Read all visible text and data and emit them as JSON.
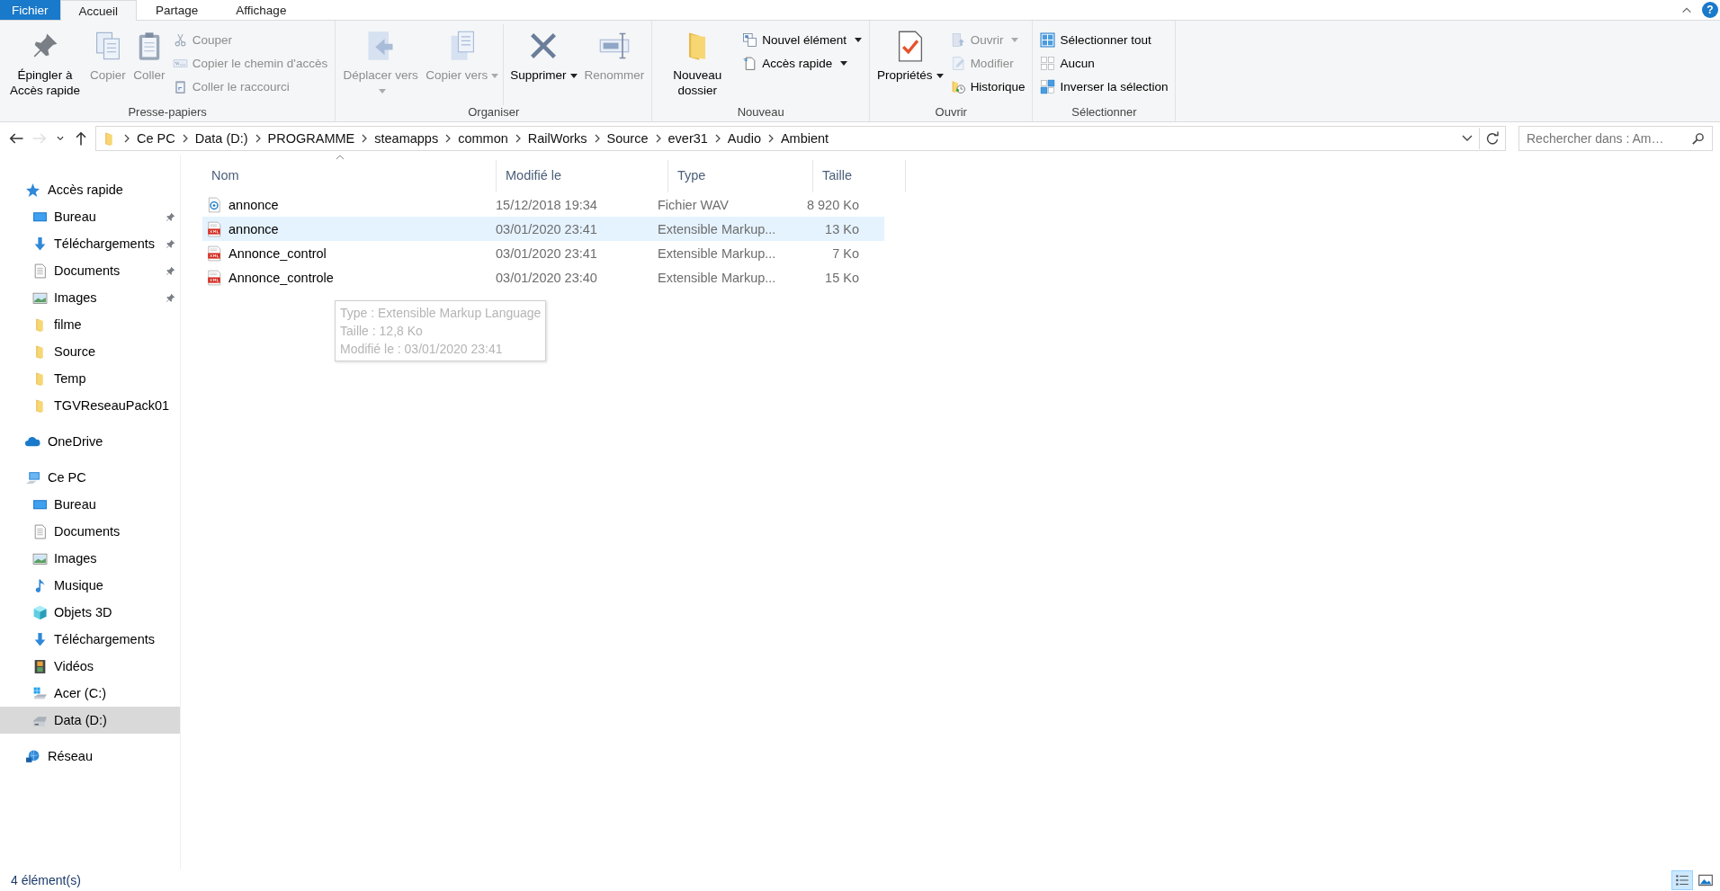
{
  "ribbon_tabs": [
    {
      "label": "Fichier",
      "kind": "file",
      "selected": false
    },
    {
      "label": "Accueil",
      "kind": "tab",
      "selected": true
    },
    {
      "label": "Partage",
      "kind": "tab",
      "selected": false
    },
    {
      "label": "Affichage",
      "kind": "tab",
      "selected": false
    }
  ],
  "help_button": {
    "label": "?"
  },
  "ribbon_groups": [
    {
      "label": "Presse-papiers",
      "large": [
        {
          "label": "Épingler à Accès rapide",
          "kind": "pin",
          "disabled": false,
          "dropdown": false
        },
        {
          "label": "Copier",
          "kind": "copy",
          "disabled": true,
          "dropdown": false
        },
        {
          "label": "Coller",
          "kind": "paste",
          "disabled": true,
          "dropdown": false
        }
      ],
      "small": [
        {
          "label": "Couper",
          "kind": "cut",
          "disabled": true,
          "dropdown": false
        },
        {
          "label": "Copier le chemin d'accès",
          "kind": "copypath",
          "disabled": true,
          "dropdown": false
        },
        {
          "label": "Coller le raccourci",
          "kind": "pasteshortcut",
          "disabled": true,
          "dropdown": false
        }
      ]
    },
    {
      "label": "Organiser",
      "large": [
        {
          "label": "Déplacer vers",
          "kind": "move",
          "disabled": true,
          "dropdown": true
        },
        {
          "label": "Copier vers",
          "kind": "copyto",
          "disabled": true,
          "dropdown": true
        },
        {
          "label": "Supprimer",
          "kind": "delete",
          "disabled": false,
          "dropdown": true
        },
        {
          "label": "Renommer",
          "kind": "rename",
          "disabled": true,
          "dropdown": false
        }
      ]
    },
    {
      "label": "Nouveau",
      "large": [
        {
          "label": "Nouveau dossier",
          "kind": "newfolder",
          "disabled": false,
          "dropdown": false
        }
      ],
      "small": [
        {
          "label": "Nouvel élément",
          "kind": "newitem",
          "disabled": false,
          "dropdown": true
        },
        {
          "label": "Accès rapide",
          "kind": "easyaccess",
          "disabled": false,
          "dropdown": true
        }
      ]
    },
    {
      "label": "Ouvrir",
      "large": [
        {
          "label": "Propriétés",
          "kind": "properties",
          "disabled": false,
          "dropdown": true
        }
      ],
      "small": [
        {
          "label": "Ouvrir",
          "kind": "open",
          "disabled": true,
          "dropdown": true
        },
        {
          "label": "Modifier",
          "kind": "edit",
          "disabled": true,
          "dropdown": false
        },
        {
          "label": "Historique",
          "kind": "history",
          "disabled": false,
          "dropdown": false
        }
      ]
    },
    {
      "label": "Sélectionner",
      "small": [
        {
          "label": "Sélectionner tout",
          "kind": "selectall",
          "disabled": false,
          "dropdown": false
        },
        {
          "label": "Aucun",
          "kind": "selectnone",
          "disabled": false,
          "dropdown": false
        },
        {
          "label": "Inverser la sélection",
          "kind": "invert",
          "disabled": false,
          "dropdown": false
        }
      ]
    }
  ],
  "nav_buttons": [
    {
      "kind": "back",
      "disabled": false
    },
    {
      "kind": "forward",
      "disabled": true
    },
    {
      "kind": "recent",
      "disabled": false
    },
    {
      "kind": "up",
      "disabled": false
    }
  ],
  "breadcrumb": [
    "Ce PC",
    "Data (D:)",
    "PROGRAMME",
    "steamapps",
    "common",
    "RailWorks",
    "Source",
    "ever31",
    "Audio",
    "Ambient"
  ],
  "search": {
    "placeholder": "Rechercher dans : Am…"
  },
  "sidebar": {
    "items": [
      {
        "label": "Accès rapide",
        "kind": "star",
        "selected": false,
        "pinned": false,
        "children": [
          {
            "label": "Bureau",
            "kind": "desktop",
            "selected": false,
            "pinned": true
          },
          {
            "label": "Téléchargements",
            "kind": "download",
            "selected": false,
            "pinned": true
          },
          {
            "label": "Documents",
            "kind": "documents",
            "selected": false,
            "pinned": true
          },
          {
            "label": "Images",
            "kind": "pictures",
            "selected": false,
            "pinned": true
          },
          {
            "label": "filme",
            "kind": "folder",
            "selected": false,
            "pinned": false
          },
          {
            "label": "Source",
            "kind": "folder",
            "selected": false,
            "pinned": false
          },
          {
            "label": "Temp",
            "kind": "folder",
            "selected": false,
            "pinned": false
          },
          {
            "label": "TGVReseauPack01",
            "kind": "folder",
            "selected": false,
            "pinned": false
          }
        ]
      },
      {
        "label": "OneDrive",
        "kind": "cloud",
        "selected": false,
        "pinned": false
      },
      {
        "label": "Ce PC",
        "kind": "pc",
        "selected": false,
        "pinned": false,
        "children": [
          {
            "label": "Bureau",
            "kind": "desktop",
            "selected": false,
            "pinned": false
          },
          {
            "label": "Documents",
            "kind": "documents",
            "selected": false,
            "pinned": false
          },
          {
            "label": "Images",
            "kind": "pictures",
            "selected": false,
            "pinned": false
          },
          {
            "label": "Musique",
            "kind": "music",
            "selected": false,
            "pinned": false
          },
          {
            "label": "Objets 3D",
            "kind": "cube",
            "selected": false,
            "pinned": false
          },
          {
            "label": "Téléchargements",
            "kind": "download",
            "selected": false,
            "pinned": false
          },
          {
            "label": "Vidéos",
            "kind": "videos",
            "selected": false,
            "pinned": false
          },
          {
            "label": "Acer (C:)",
            "kind": "windrive",
            "selected": false,
            "pinned": false
          },
          {
            "label": "Data (D:)",
            "kind": "drive",
            "selected": true,
            "pinned": false
          }
        ]
      },
      {
        "label": "Réseau",
        "kind": "network",
        "selected": false,
        "pinned": false
      }
    ]
  },
  "table": {
    "columns": [
      {
        "label": "Nom",
        "sorted": true
      },
      {
        "label": "Modifié le",
        "sorted": false
      },
      {
        "label": "Type",
        "sorted": false
      },
      {
        "label": "Taille",
        "sorted": false
      }
    ],
    "rows": [
      {
        "name": "annonce",
        "modified": "15/12/2018 19:34",
        "type": "Fichier WAV",
        "size": "8 920 Ko",
        "kind": "wav",
        "selected": false
      },
      {
        "name": "annonce",
        "modified": "03/01/2020 23:41",
        "type": "Extensible Markup...",
        "size": "13 Ko",
        "kind": "xml",
        "selected": true
      },
      {
        "name": "Annonce_control",
        "modified": "03/01/2020 23:41",
        "type": "Extensible Markup...",
        "size": "7 Ko",
        "kind": "xml",
        "selected": false
      },
      {
        "name": "Annonce_controle",
        "modified": "03/01/2020 23:40",
        "type": "Extensible Markup...",
        "size": "15 Ko",
        "kind": "xml",
        "selected": false
      }
    ]
  },
  "tooltip": {
    "lines": [
      "Type : Extensible Markup Language",
      "Taille : 12,8 Ko",
      "Modifié le : 03/01/2020 23:41"
    ]
  },
  "status_bar": {
    "text": "4 élément(s)",
    "views": [
      {
        "kind": "details",
        "selected": true
      },
      {
        "kind": "largeicons",
        "selected": false
      }
    ]
  }
}
